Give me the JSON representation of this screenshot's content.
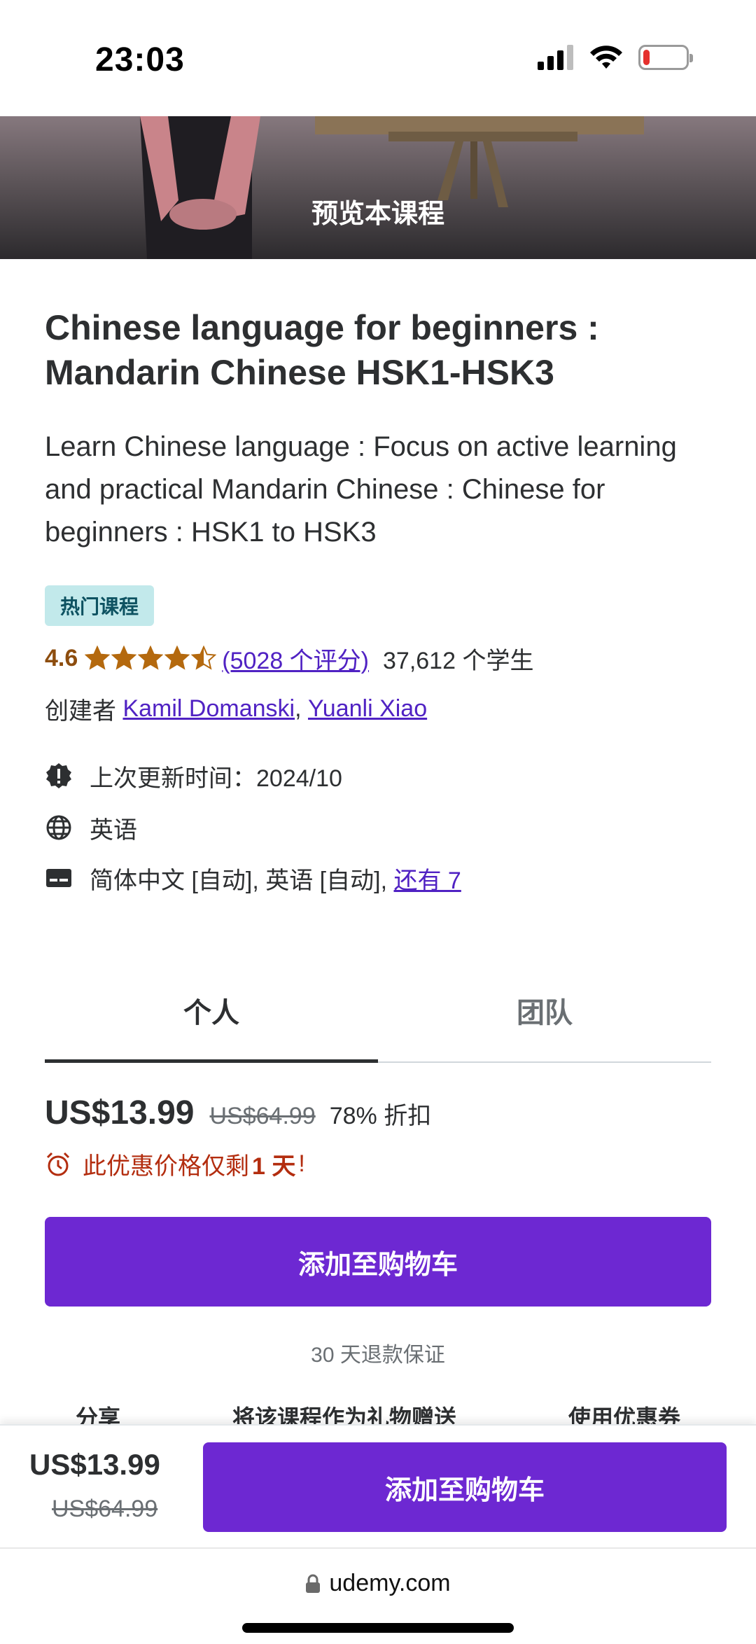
{
  "status_bar": {
    "time": "23:03",
    "battery_level": 0.15
  },
  "preview": {
    "label": "预览本课程"
  },
  "course": {
    "title": "Chinese language for beginners : Mandarin Chinese HSK1-HSK3",
    "subtitle": "Learn Chinese language : Focus on active learning and practical Mandarin Chinese : Chinese for beginners : HSK1 to HSK3",
    "badge": "热门课程",
    "rating": "4.6",
    "rating_stars": 4.5,
    "reviews": "(5028 个评分)",
    "students": "37,612 个学生",
    "creator_prefix": "创建者",
    "creators": [
      "Kamil Domanski",
      "Yuanli Xiao"
    ],
    "creator_separator": ",",
    "last_updated": "上次更新时间：2024/10",
    "language": "英语",
    "captions": "简体中文 [自动], 英语 [自动],",
    "captions_more": "还有 7"
  },
  "tabs": [
    {
      "label": "个人",
      "active": true
    },
    {
      "label": "团队",
      "active": false
    }
  ],
  "pricing": {
    "current": "US$13.99",
    "original": "US$64.99",
    "discount": "78% 折扣",
    "deal_prefix": "此优惠价格仅剩",
    "deal_bold": "1 天",
    "deal_suffix": "!",
    "cart_label": "添加至购物车",
    "guarantee": "30 天退款保证"
  },
  "actions": {
    "share": "分享",
    "gift": "将该课程作为礼物赠送",
    "coupon": "使用优惠券"
  },
  "sticky_bar": {
    "price": "US$13.99",
    "original": "US$64.99",
    "cart_label": "添加至购物车"
  },
  "browser": {
    "url": "udemy.com"
  },
  "colors": {
    "primary": "#6d28d2",
    "link": "#5022c3",
    "rating": "#b4690e",
    "badge_bg": "#c2e9eb",
    "deal": "#b32d0f"
  }
}
